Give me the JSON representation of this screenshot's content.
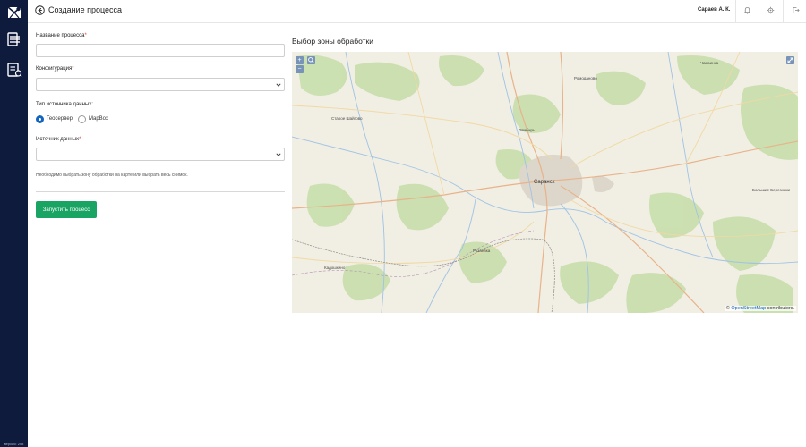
{
  "sidebar": {
    "items": [
      {
        "icon": "map-logo-icon"
      },
      {
        "icon": "process-list-icon"
      },
      {
        "icon": "report-icon"
      }
    ],
    "version": "версия: 208"
  },
  "header": {
    "title": "Создание процесса",
    "user_name": "Сараев А. К."
  },
  "form": {
    "process_name": {
      "label": "Название процесса",
      "required_mark": "*",
      "value": ""
    },
    "configuration": {
      "label": "Конфигурация",
      "required_mark": "*",
      "value": ""
    },
    "source_type": {
      "label": "Тип источника данных:",
      "options": [
        {
          "label": "Геосервер",
          "selected": true
        },
        {
          "label": "MapBox",
          "selected": false
        }
      ]
    },
    "data_source": {
      "label": "Источник данных",
      "required_mark": "*",
      "value": ""
    },
    "hint": "Необходимо выбрать зону обработки на карте или выбрать весь снимок.",
    "run_button": "Запустить процесс"
  },
  "map": {
    "title": "Выбор зоны обработки",
    "zoom_in": "+",
    "zoom_out": "−",
    "attribution_prefix": "© ",
    "attribution_link": "OpenStreetMap",
    "attribution_suffix": " contributors.",
    "places": {
      "city": "Саранск",
      "p1": "Старое Шайгово",
      "p2": "Лямбирь",
      "p3": "Рузаевка",
      "p4": "Кадошкино",
      "p5": "Ромоданово",
      "p6": "Чамзинка",
      "p7": "Большие Березники"
    }
  }
}
